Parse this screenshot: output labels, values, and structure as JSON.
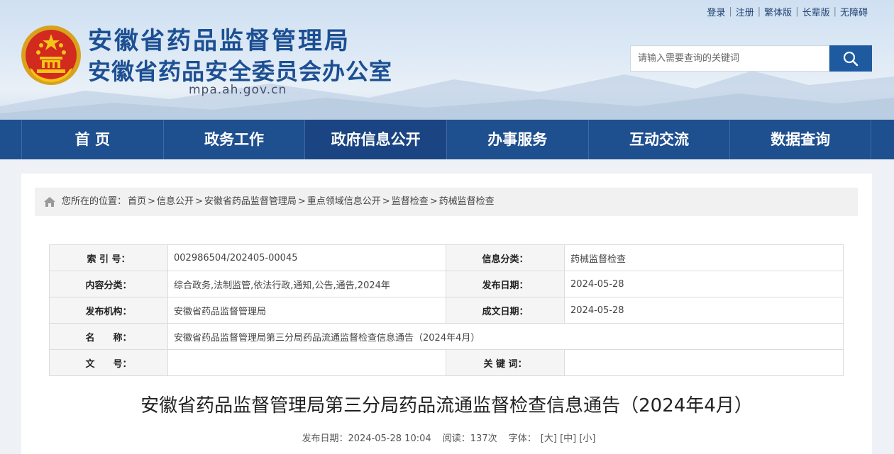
{
  "header": {
    "title_line1": "安徽省药品监督管理局",
    "title_line2": "安徽省药品安全委员会办公室",
    "domain": "mpa.ah.gov.cn"
  },
  "toplinks": [
    "登录",
    "注册",
    "繁体版",
    "长辈版",
    "无障碍"
  ],
  "search": {
    "placeholder": "请输入需要查询的关键词"
  },
  "nav": [
    "首 页",
    "政务工作",
    "政府信息公开",
    "办事服务",
    "互动交流",
    "数据查询"
  ],
  "breadcrumb": {
    "prefix": "您所在的位置：",
    "items": [
      "首页",
      "信息公开",
      "安徽省药品监督管理局",
      "重点领域信息公开",
      "监督检查",
      "药械监督检查"
    ],
    "separator": ">"
  },
  "meta": {
    "index_label": "索 引 号：",
    "index_value": "002986504/202405-00045",
    "category_label": "信息分类：",
    "category_value": "药械监督检查",
    "content_label": "内容分类：",
    "content_value": "综合政务,法制监管,依法行政,通知,公告,通告,2024年",
    "pubdate_label": "发布日期：",
    "pubdate_value": "2024-05-28",
    "org_label": "发布机构：",
    "org_value": "安徽省药品监督管理局",
    "made_label": "成文日期：",
    "made_value": "2024-05-28",
    "name_label": "名　　称：",
    "name_value": "安徽省药品监督管理局第三分局药品流通监督检查信息通告（2024年4月）",
    "docno_label": "文　　号：",
    "docno_value": "",
    "keyword_label": "关 键 词：",
    "keyword_value": ""
  },
  "article": {
    "title": "安徽省药品监督管理局第三分局药品流通监督检查信息通告（2024年4月）",
    "pubdate": "发布日期：2024-05-28 10:04",
    "views": "阅读：137次",
    "font_label": "字体：",
    "font_large": "[大]",
    "font_medium": "[中]",
    "font_small": "[小]"
  },
  "colors": {
    "brand": "#1e4f8f",
    "title": "#1c4f92",
    "search_button": "#1e5aa0"
  }
}
